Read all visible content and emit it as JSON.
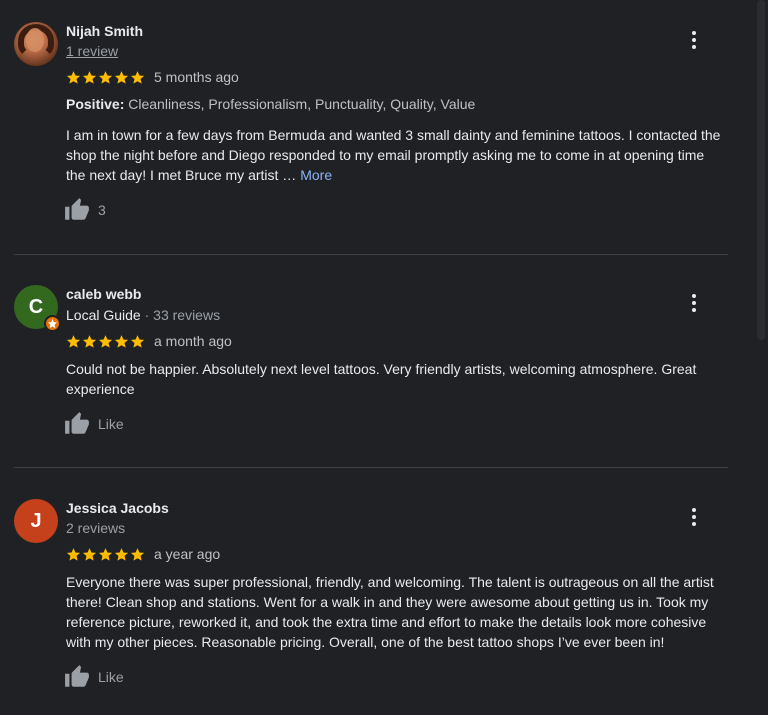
{
  "colors": {
    "background": "#202124",
    "star": "#fbbc04",
    "link": "#8ab4f8",
    "divider": "#3c4043",
    "local_guide_badge": "#e8710a"
  },
  "reviews": [
    {
      "author": "Nijah Smith",
      "avatar_type": "photo",
      "meta": "1 review",
      "rating": 5,
      "time": "5 months ago",
      "positive_label": "Positive:",
      "positive_text": "Cleanliness, Professionalism, Punctuality, Quality, Value",
      "text": "I am in town for a few days from Bermuda and wanted 3 small dainty and feminine tattoos. I contacted the shop the night before and Diego responded to my email promptly asking me to come in at opening time the next day! I met Bruce my artist …",
      "more_label": "More",
      "like_label": "3"
    },
    {
      "author": "caleb webb",
      "avatar_type": "initial",
      "avatar_initial": "C",
      "avatar_color": "#33691e",
      "local_guide": "Local Guide",
      "meta": "· 33 reviews",
      "rating": 5,
      "time": "a month ago",
      "text": "Could not be happier. Absolutely next level tattoos. Very friendly artists, welcoming atmosphere. Great experience",
      "like_label": "Like"
    },
    {
      "author": "Jessica Jacobs",
      "avatar_type": "initial",
      "avatar_initial": "J",
      "avatar_color": "#c5411b",
      "meta": "2 reviews",
      "rating": 5,
      "time": "a year ago",
      "text": "Everyone there was super professional, friendly, and welcoming. The talent is outrageous on all the artist there! Clean shop and stations. Went for a walk in and they were awesome about getting us in. Took my reference picture, reworked it, and took the extra time and effort to make the details look more cohesive with my other pieces. Reasonable pricing. Overall, one of the best tattoo shops I’ve ever been in!",
      "like_label": "Like"
    }
  ]
}
